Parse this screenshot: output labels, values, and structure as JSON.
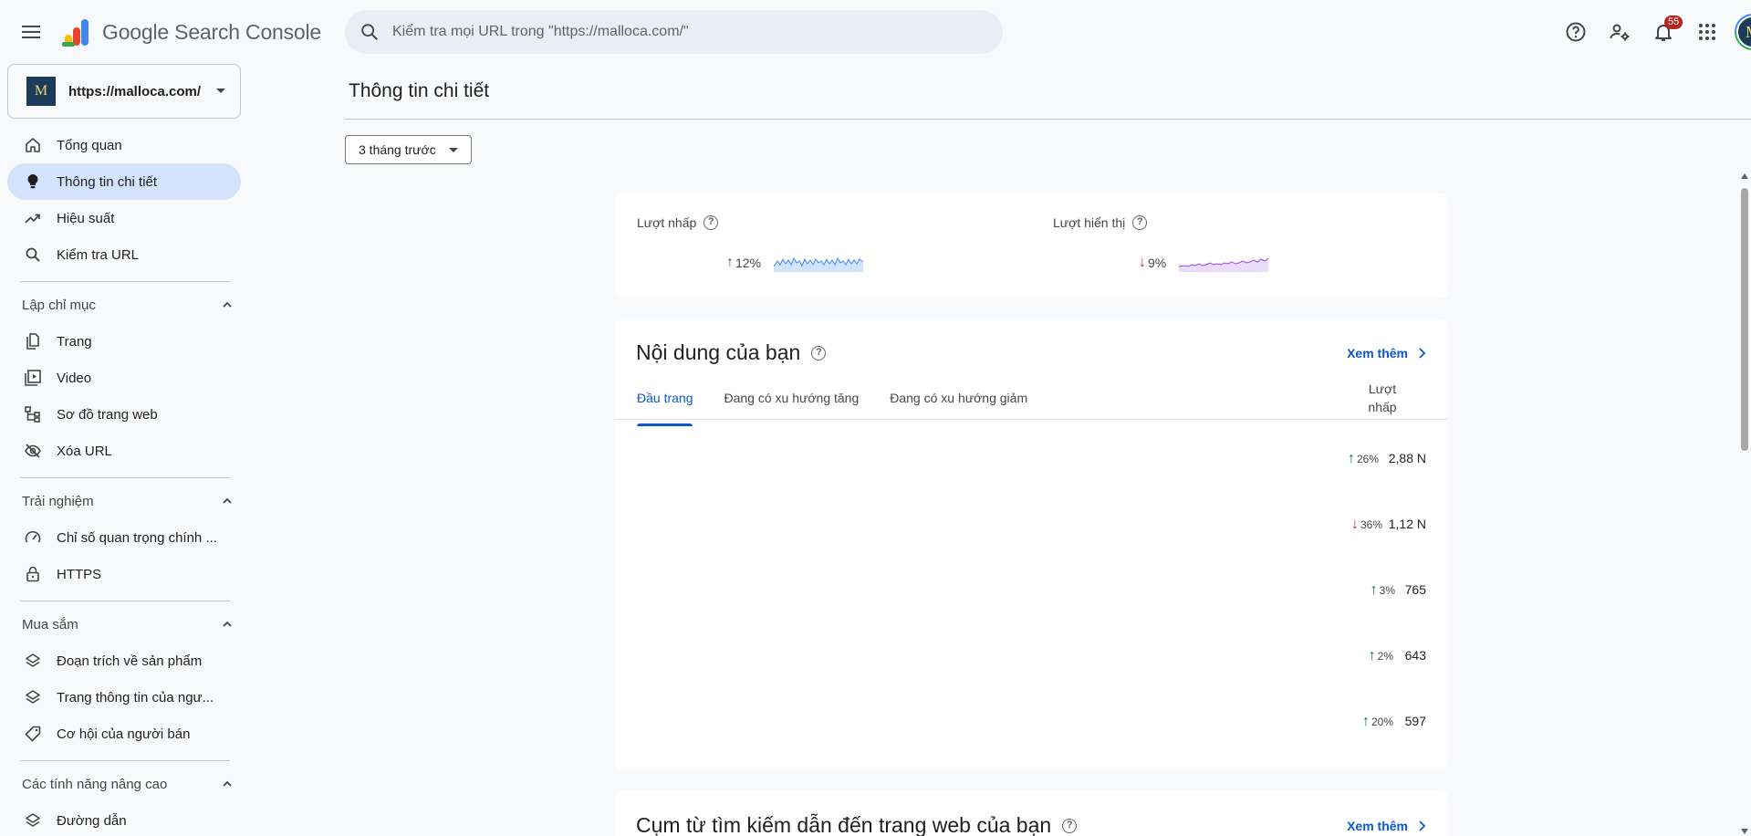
{
  "app": {
    "logo_google": "Google",
    "logo_product": "Search Console"
  },
  "search": {
    "placeholder": "Kiểm tra mọi URL trong \"https://malloca.com/\""
  },
  "header": {
    "notifications_count": "55",
    "avatar_letter": "M"
  },
  "property": {
    "url": "https://malloca.com/",
    "logo_letter": "M"
  },
  "sidebar": {
    "items": [
      {
        "label": "Tổng quan",
        "icon": "home-icon"
      },
      {
        "label": "Thông tin chi tiết",
        "icon": "lightbulb-icon",
        "active": true
      },
      {
        "label": "Hiệu suất",
        "icon": "trending-icon"
      },
      {
        "label": "Kiểm tra URL",
        "icon": "search-icon"
      }
    ],
    "sections": [
      {
        "title": "Lập chỉ mục",
        "items": [
          {
            "label": "Trang",
            "icon": "pages-icon"
          },
          {
            "label": "Video",
            "icon": "video-icon"
          },
          {
            "label": "Sơ đồ trang web",
            "icon": "sitemap-icon"
          },
          {
            "label": "Xóa URL",
            "icon": "eye-off-icon"
          }
        ]
      },
      {
        "title": "Trải nghiệm",
        "items": [
          {
            "label": "Chỉ số quan trọng chính ...",
            "icon": "speed-icon"
          },
          {
            "label": "HTTPS",
            "icon": "lock-icon"
          }
        ]
      },
      {
        "title": "Mua sắm",
        "items": [
          {
            "label": "Đoạn trích về sản phẩm",
            "icon": "layers-icon"
          },
          {
            "label": "Trang thông tin của ngư...",
            "icon": "layers-icon"
          },
          {
            "label": "Cơ hội của người bán",
            "icon": "tag-icon"
          }
        ]
      },
      {
        "title": "Các tính năng nâng cao",
        "items": [
          {
            "label": "Đường dẫn",
            "icon": "layers-icon"
          }
        ]
      }
    ]
  },
  "main": {
    "title": "Thông tin chi tiết",
    "period": "3 tháng trước",
    "metrics": [
      {
        "label": "Lượt nhấp",
        "change": "12%",
        "direction": "up",
        "color": "#4285f4"
      },
      {
        "label": "Lượt hiển thị",
        "change": "9%",
        "direction": "down",
        "color": "#a142f4"
      }
    ],
    "content_card": {
      "title": "Nội dung của bạn",
      "more": "Xem thêm",
      "tabs": [
        "Đầu trang",
        "Đang có xu hướng tăng",
        "Đang có xu hướng giảm"
      ],
      "column_header": "Lượt nhấp",
      "rows": [
        {
          "change": "26%",
          "direction": "up",
          "value": "2,88 N"
        },
        {
          "change": "36%",
          "direction": "down",
          "value": "1,12 N"
        },
        {
          "change": "3%",
          "direction": "up",
          "value": "765"
        },
        {
          "change": "2%",
          "direction": "up",
          "value": "643"
        },
        {
          "change": "20%",
          "direction": "up",
          "value": "597"
        }
      ]
    },
    "queries_card": {
      "title": "Cụm từ tìm kiếm dẫn đến trang web của bạn",
      "more": "Xem thêm"
    }
  },
  "colors": {
    "accent": "#0b57d0",
    "active_nav": "#d3e3fd",
    "up": "#137333",
    "down": "#c5221f"
  }
}
